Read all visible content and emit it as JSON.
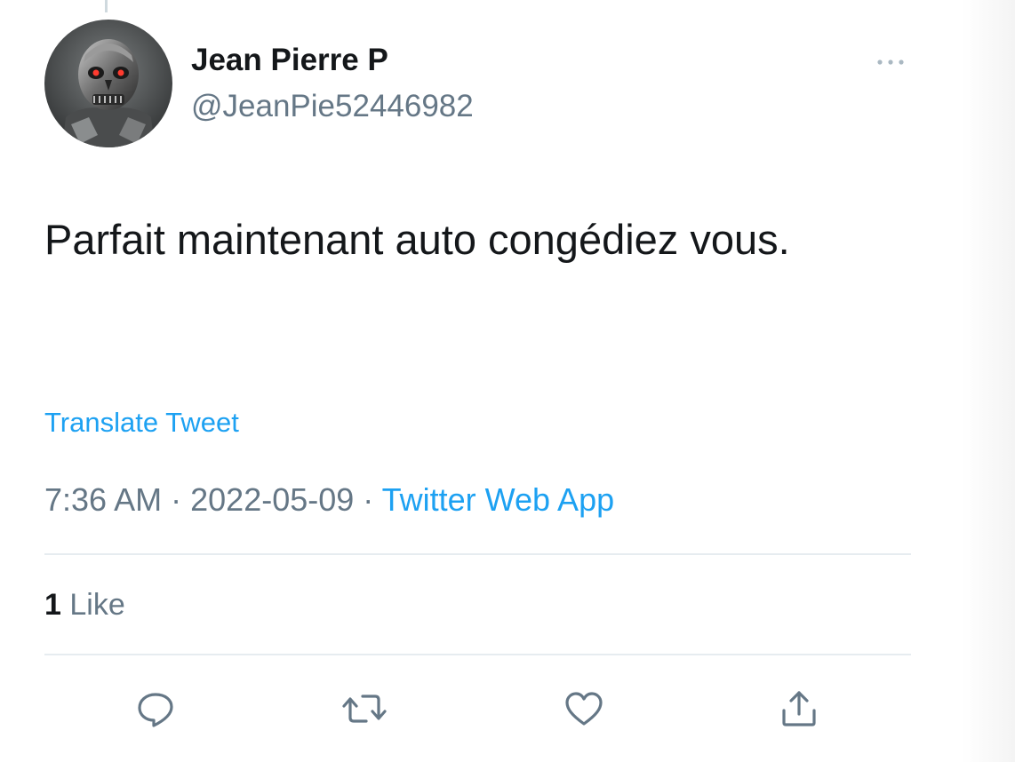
{
  "tweet": {
    "author": {
      "display_name": "Jean Pierre P",
      "handle": "@JeanPie52446982",
      "avatar_icon": "terminator-avatar"
    },
    "text": "Parfait maintenant auto congédiez vous.",
    "translate_label": "Translate Tweet",
    "time": "7:36 AM",
    "date": "2022-05-09",
    "separator": "·",
    "source": "Twitter Web App",
    "likes": {
      "count": "1",
      "label": "Like"
    }
  },
  "icons": {
    "more": "more-horizontal-icon",
    "reply": "reply-icon",
    "retweet": "retweet-icon",
    "like": "heart-icon",
    "share": "share-icon"
  },
  "colors": {
    "text": "#14171a",
    "secondary": "#657786",
    "link": "#1da1f2",
    "divider": "#e6ecf0"
  }
}
